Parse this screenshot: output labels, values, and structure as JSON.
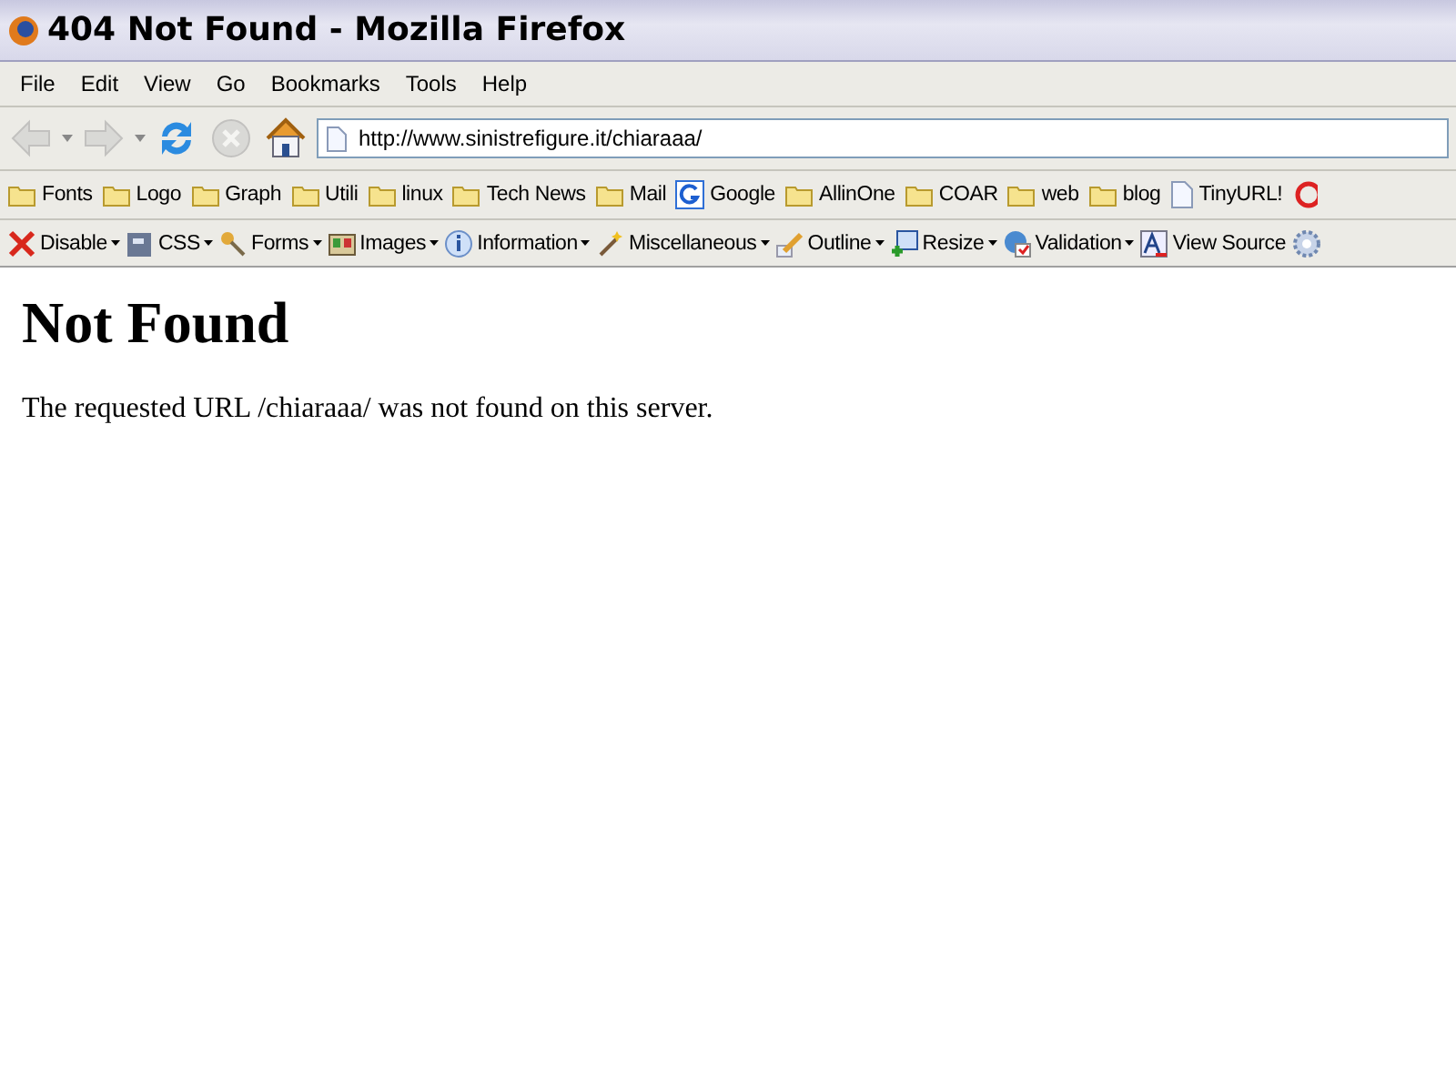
{
  "window": {
    "title": "404 Not Found - Mozilla Firefox"
  },
  "menu": [
    "File",
    "Edit",
    "View",
    "Go",
    "Bookmarks",
    "Tools",
    "Help"
  ],
  "navigation": {
    "back_disabled": true,
    "forward_disabled": true,
    "stop_disabled": true,
    "url": "http://www.sinistrefigure.it/chiaraaa/"
  },
  "bookmarks": [
    {
      "kind": "folder",
      "label": "Fonts"
    },
    {
      "kind": "folder",
      "label": "Logo"
    },
    {
      "kind": "folder",
      "label": "Graph"
    },
    {
      "kind": "folder",
      "label": "Utili"
    },
    {
      "kind": "folder",
      "label": "linux"
    },
    {
      "kind": "folder",
      "label": "Tech News"
    },
    {
      "kind": "folder",
      "label": "Mail"
    },
    {
      "kind": "google",
      "label": "Google"
    },
    {
      "kind": "folder",
      "label": "AllinOne"
    },
    {
      "kind": "folder",
      "label": "COAR"
    },
    {
      "kind": "folder",
      "label": "web"
    },
    {
      "kind": "folder",
      "label": "blog"
    },
    {
      "kind": "page",
      "label": "TinyURL!"
    }
  ],
  "developer_toolbar": [
    {
      "label": "Disable",
      "dropdown": true
    },
    {
      "label": "CSS",
      "dropdown": true
    },
    {
      "label": "Forms",
      "dropdown": true
    },
    {
      "label": "Images",
      "dropdown": true
    },
    {
      "label": "Information",
      "dropdown": true
    },
    {
      "label": "Miscellaneous",
      "dropdown": true
    },
    {
      "label": "Outline",
      "dropdown": true
    },
    {
      "label": "Resize",
      "dropdown": true
    },
    {
      "label": "Validation",
      "dropdown": true
    },
    {
      "label": "View Source",
      "dropdown": false
    }
  ],
  "page": {
    "heading": "Not Found",
    "message": "The requested URL /chiaraaa/ was not found on this server."
  }
}
